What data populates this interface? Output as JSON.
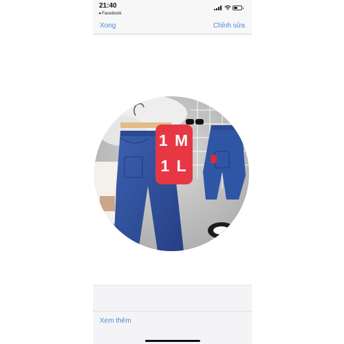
{
  "status_bar": {
    "time": "21:40",
    "back_app": "◂ Facebook",
    "signal_icon": "cellular-signal-icon",
    "wifi_icon": "wifi-icon",
    "battery_icon": "battery-icon",
    "battery_level": 0.45
  },
  "nav": {
    "done_label": "Xong",
    "edit_label": "Chỉnh sửa"
  },
  "photo": {
    "subject": "jeans-product-photo",
    "label_line1": "1 M",
    "label_line2": "1 L",
    "label_color": "#e73745"
  },
  "toolbar": {
    "more_label": "Xem thêm"
  },
  "colors": {
    "accent": "#4a8bd9",
    "denim": "#2c4f9a"
  }
}
